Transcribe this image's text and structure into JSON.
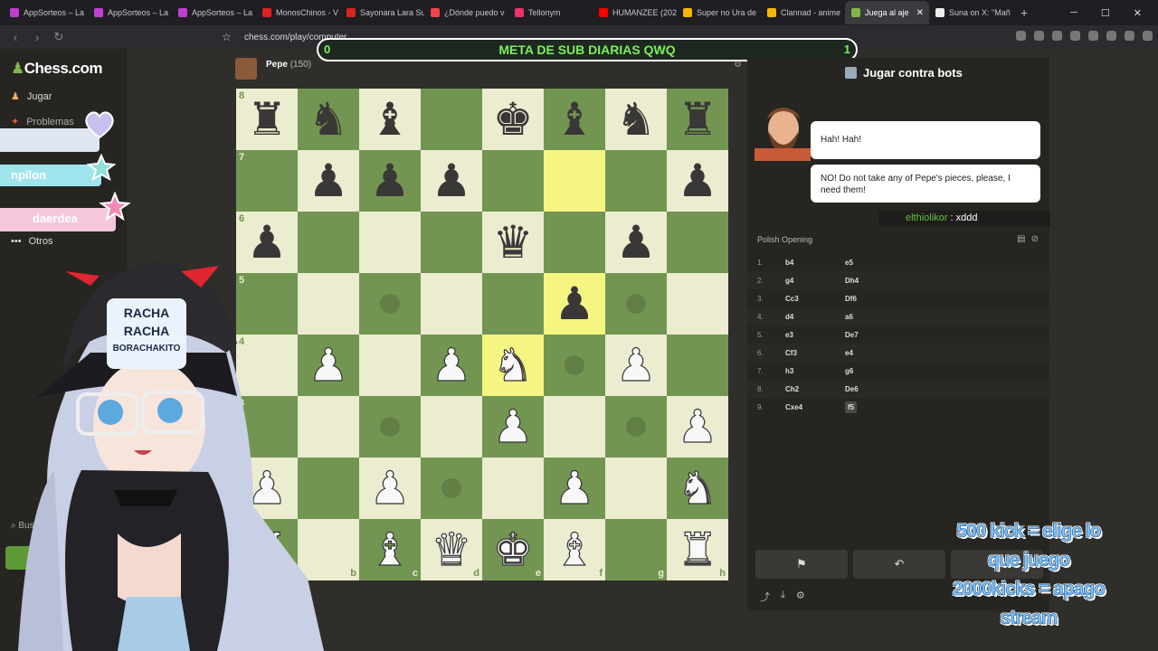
{
  "tabs": [
    {
      "label": "AppSorteos – La",
      "fav": "#c03fd0"
    },
    {
      "label": "AppSorteos – La",
      "fav": "#c03fd0"
    },
    {
      "label": "AppSorteos – La",
      "fav": "#c03fd0"
    },
    {
      "label": "MonosChinos - V",
      "fav": "#d22"
    },
    {
      "label": "Sayonara Lara Su",
      "fav": "#d22"
    },
    {
      "label": "¿Dónde puedo v",
      "fav": "#e44"
    },
    {
      "label": "Tellonym",
      "fav": "#e8336b"
    },
    {
      "label": "HUMANZEE (202",
      "fav": "#f00"
    },
    {
      "label": "Super no Ura de",
      "fav": "#f5b700"
    },
    {
      "label": "Clannad - anime",
      "fav": "#f5b700"
    },
    {
      "label": "Juega al aje",
      "fav": "#81b64c",
      "active": true
    },
    {
      "label": "Suna on X: \"Mañ",
      "fav": "#eee"
    }
  ],
  "url": "chess.com/play/computer",
  "goal": {
    "text": "META DE SUB DIARIAS QWQ",
    "left": "0",
    "right": "1"
  },
  "sidebar": {
    "logo": "Chess.com",
    "play": "Jugar",
    "puzzles": "Problemas",
    "more": "Otros",
    "search": "Buscar",
    "register": "Registrarse",
    "pills": [
      "",
      "npilon",
      "daerdea"
    ]
  },
  "opponent": {
    "name": "Pepe",
    "rating": "(150)"
  },
  "board": {
    "rows": [
      [
        "bR",
        "bN",
        "bB",
        "",
        "bK",
        "bB",
        "bN",
        "bR"
      ],
      [
        "",
        "bP",
        "bP",
        "bP",
        "",
        "",
        "",
        "bP"
      ],
      [
        "bP",
        "",
        "",
        "",
        "bQ",
        "",
        "bP",
        ""
      ],
      [
        "",
        "",
        "",
        "",
        "",
        "bP",
        "",
        ""
      ],
      [
        "",
        "wP",
        "",
        "wP",
        "wN",
        "",
        "wP",
        ""
      ],
      [
        "",
        "",
        "",
        "",
        "wP",
        "",
        "",
        "wP"
      ],
      [
        "wP",
        "",
        "wP",
        "",
        "",
        "wP",
        "",
        "wN"
      ],
      [
        "wR",
        "",
        "wB",
        "wQ",
        "wK",
        "wB",
        "",
        "wR"
      ]
    ],
    "dots": [
      "4,3",
      "4,5",
      "3,2",
      "3,6",
      "5,2",
      "5,6",
      "6,3"
    ],
    "highlight": [
      "1,5",
      "3,5",
      "4,4"
    ],
    "ranks": [
      "8",
      "7",
      "6",
      "5",
      "4",
      "3",
      "2",
      "1"
    ],
    "files": [
      "a",
      "b",
      "c",
      "d",
      "e",
      "f",
      "g",
      "h"
    ]
  },
  "panel": {
    "title": "Jugar contra bots",
    "bubble1": "Hah! Hah!",
    "bubble2": "NO! Do not take any of Pepe's pieces, please, I need them!",
    "chat_user": "elthiolikor",
    "chat_msg": " : xddd",
    "opening": "Polish Opening",
    "moves": [
      [
        "1.",
        "b4",
        "e5"
      ],
      [
        "2.",
        "g4",
        "Dh4"
      ],
      [
        "3.",
        "Cc3",
        "Df6"
      ],
      [
        "4.",
        "d4",
        "a6"
      ],
      [
        "5.",
        "e3",
        "De7"
      ],
      [
        "6.",
        "Cf3",
        "e4"
      ],
      [
        "7.",
        "h3",
        "g6"
      ],
      [
        "8.",
        "Ch2",
        "De6"
      ],
      [
        "9.",
        "Cxe4",
        "f5"
      ]
    ]
  },
  "overlay": {
    "line1": "500 kick = elige lo",
    "line2": "que juego",
    "line3": "2000kicks = apago",
    "line4": "stream"
  },
  "racha": {
    "l1": "RACHA",
    "l2": "RACHA",
    "l3": "BORACHAKITO"
  },
  "colors": {
    "light": "#ebecd0",
    "dark": "#739552",
    "highlight": "#f5f682",
    "accent": "#81b64c"
  }
}
